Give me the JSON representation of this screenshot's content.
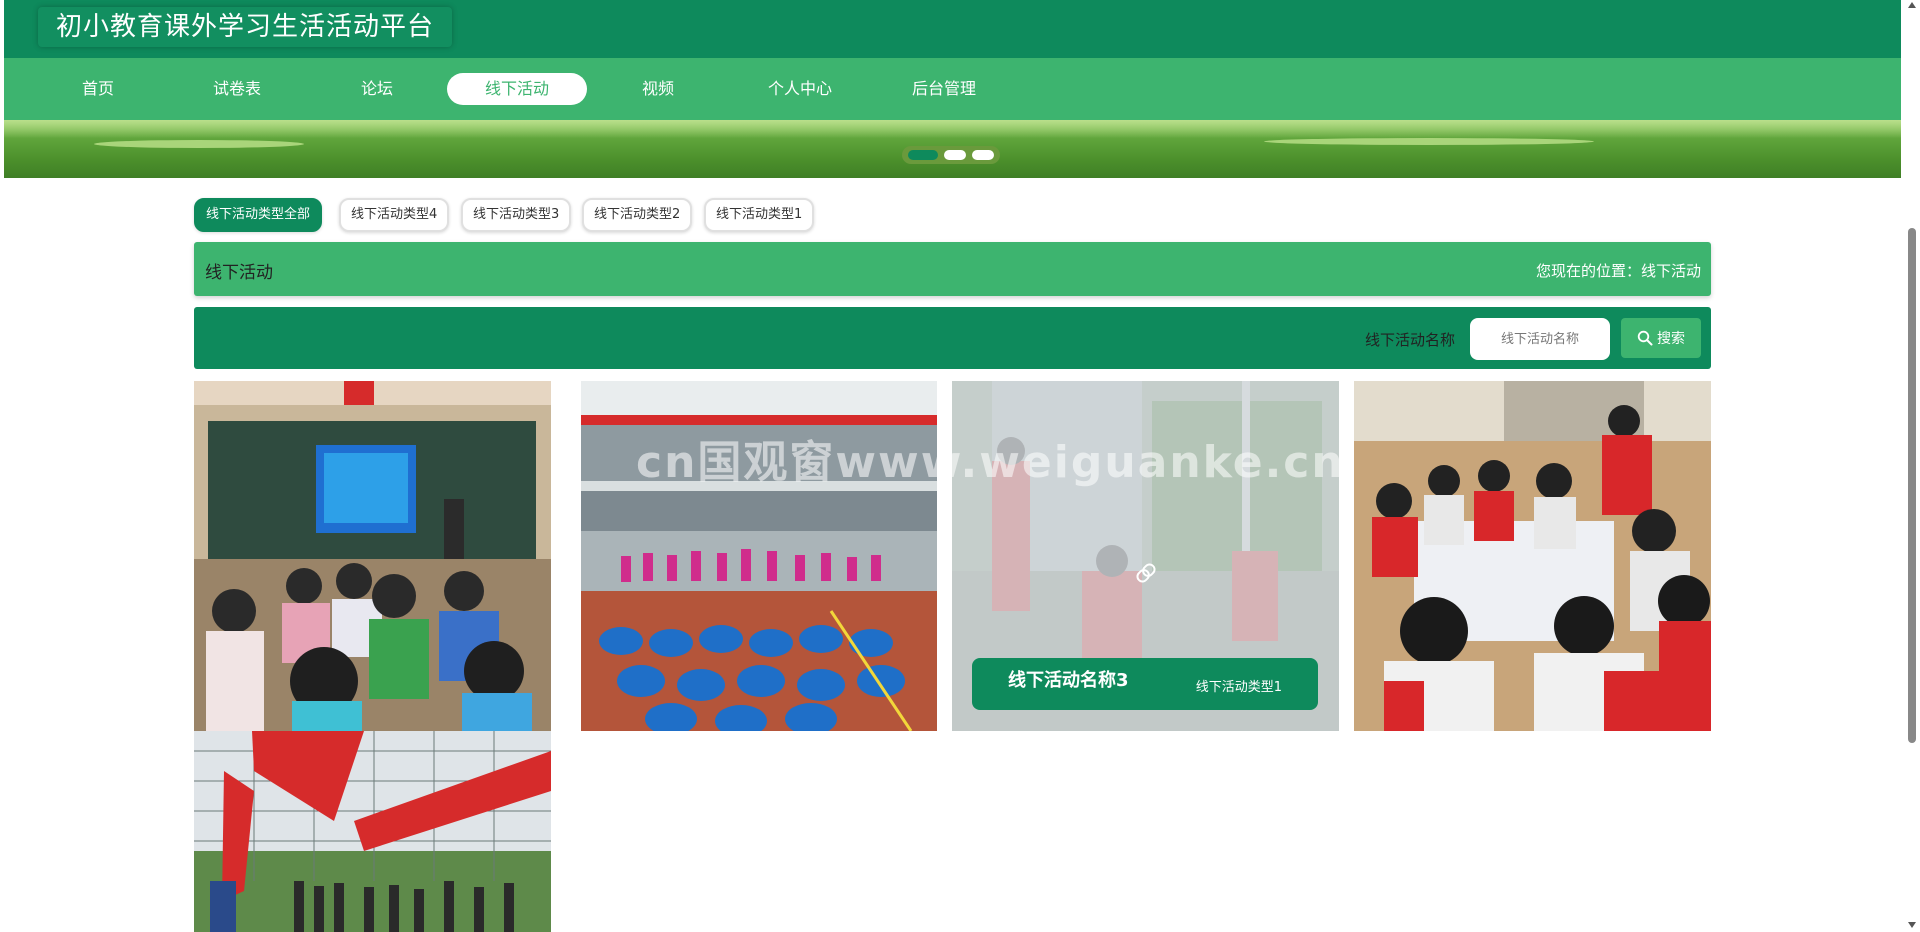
{
  "header": {
    "site_title": "初小教育课外学习生活活动平台"
  },
  "nav": {
    "items": [
      {
        "label": "首页"
      },
      {
        "label": "试卷表"
      },
      {
        "label": "论坛"
      },
      {
        "label": "线下活动"
      },
      {
        "label": "视频"
      },
      {
        "label": "个人中心"
      },
      {
        "label": "后台管理"
      }
    ],
    "active": "线下活动"
  },
  "banner": {
    "slides": 3,
    "active_slide": 1
  },
  "categories": {
    "items": [
      {
        "label": "线下活动类型全部"
      },
      {
        "label": "线下活动类型4"
      },
      {
        "label": "线下活动类型3"
      },
      {
        "label": "线下活动类型2"
      },
      {
        "label": "线下活动类型1"
      }
    ],
    "active": "线下活动类型全部"
  },
  "section": {
    "title": "线下活动",
    "breadcrumb": "您现在的位置：线下活动"
  },
  "search": {
    "label": "线下活动名称",
    "placeholder": "线下活动名称",
    "button": "搜索"
  },
  "cards": [
    {
      "name": "",
      "type": "",
      "scene": "classroom"
    },
    {
      "name": "",
      "type": "",
      "scene": "gym-dance"
    },
    {
      "name": "线下活动名称3",
      "type": "线下活动类型1",
      "scene": "outdoor-volunteers",
      "hovered": true
    },
    {
      "name": "",
      "type": "",
      "scene": "group-drawing"
    },
    {
      "name": "",
      "type": "",
      "scene": "flag-ceremony"
    }
  ],
  "watermark": "cn国观窗www.weiguanke.cn",
  "colors": {
    "primary_dark": "#0e8a5c",
    "primary_light": "#3db46f"
  }
}
